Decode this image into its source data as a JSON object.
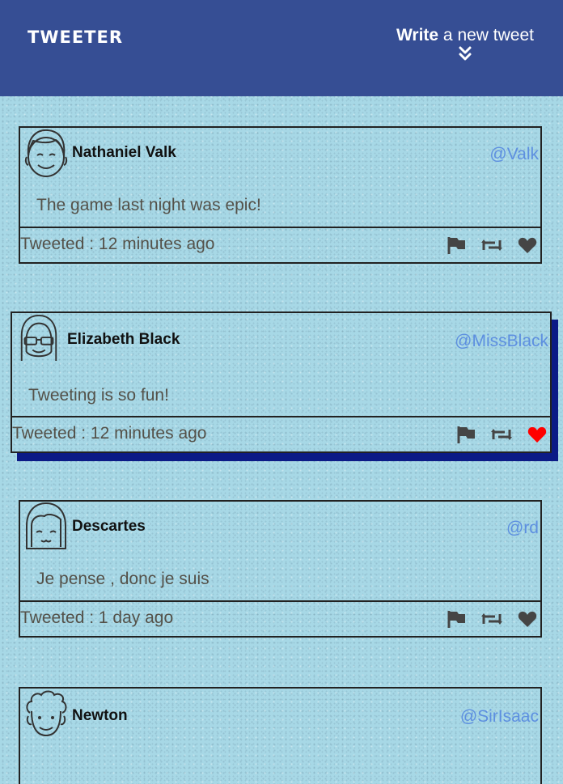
{
  "nav": {
    "brand": "TWEETER",
    "compose_bold": "Write",
    "compose_rest": " a new tweet"
  },
  "colors": {
    "nav_bg": "#364e94",
    "page_bg": "#a7d8e6",
    "handle": "#5d8fe0",
    "liked": "#ff0000",
    "icon": "#545149",
    "hover_shadow": "#0b1a86"
  },
  "tweets": [
    {
      "name": "Nathaniel Valk",
      "handle": "@Valk",
      "content": "The game last night was epic!",
      "time": "Tweeted : 12 minutes ago",
      "avatar_icon": "smiling-man-avatar-icon",
      "liked": false,
      "hovered": false
    },
    {
      "name": "Elizabeth Black",
      "handle": "@MissBlack",
      "content": "Tweeting is so fun!",
      "time": "Tweeted : 12 minutes ago",
      "avatar_icon": "woman-sunglasses-avatar-icon",
      "liked": true,
      "hovered": true
    },
    {
      "name": "Descartes",
      "handle": "@rd",
      "content": "Je pense , donc je suis",
      "time": "Tweeted : 1 day ago",
      "avatar_icon": "woman-bob-hair-avatar-icon",
      "liked": false,
      "hovered": false
    },
    {
      "name": "Newton",
      "handle": "@SirIsaac",
      "content": "",
      "time": "",
      "avatar_icon": "curly-hair-man-avatar-icon",
      "liked": false,
      "hovered": false
    }
  ]
}
